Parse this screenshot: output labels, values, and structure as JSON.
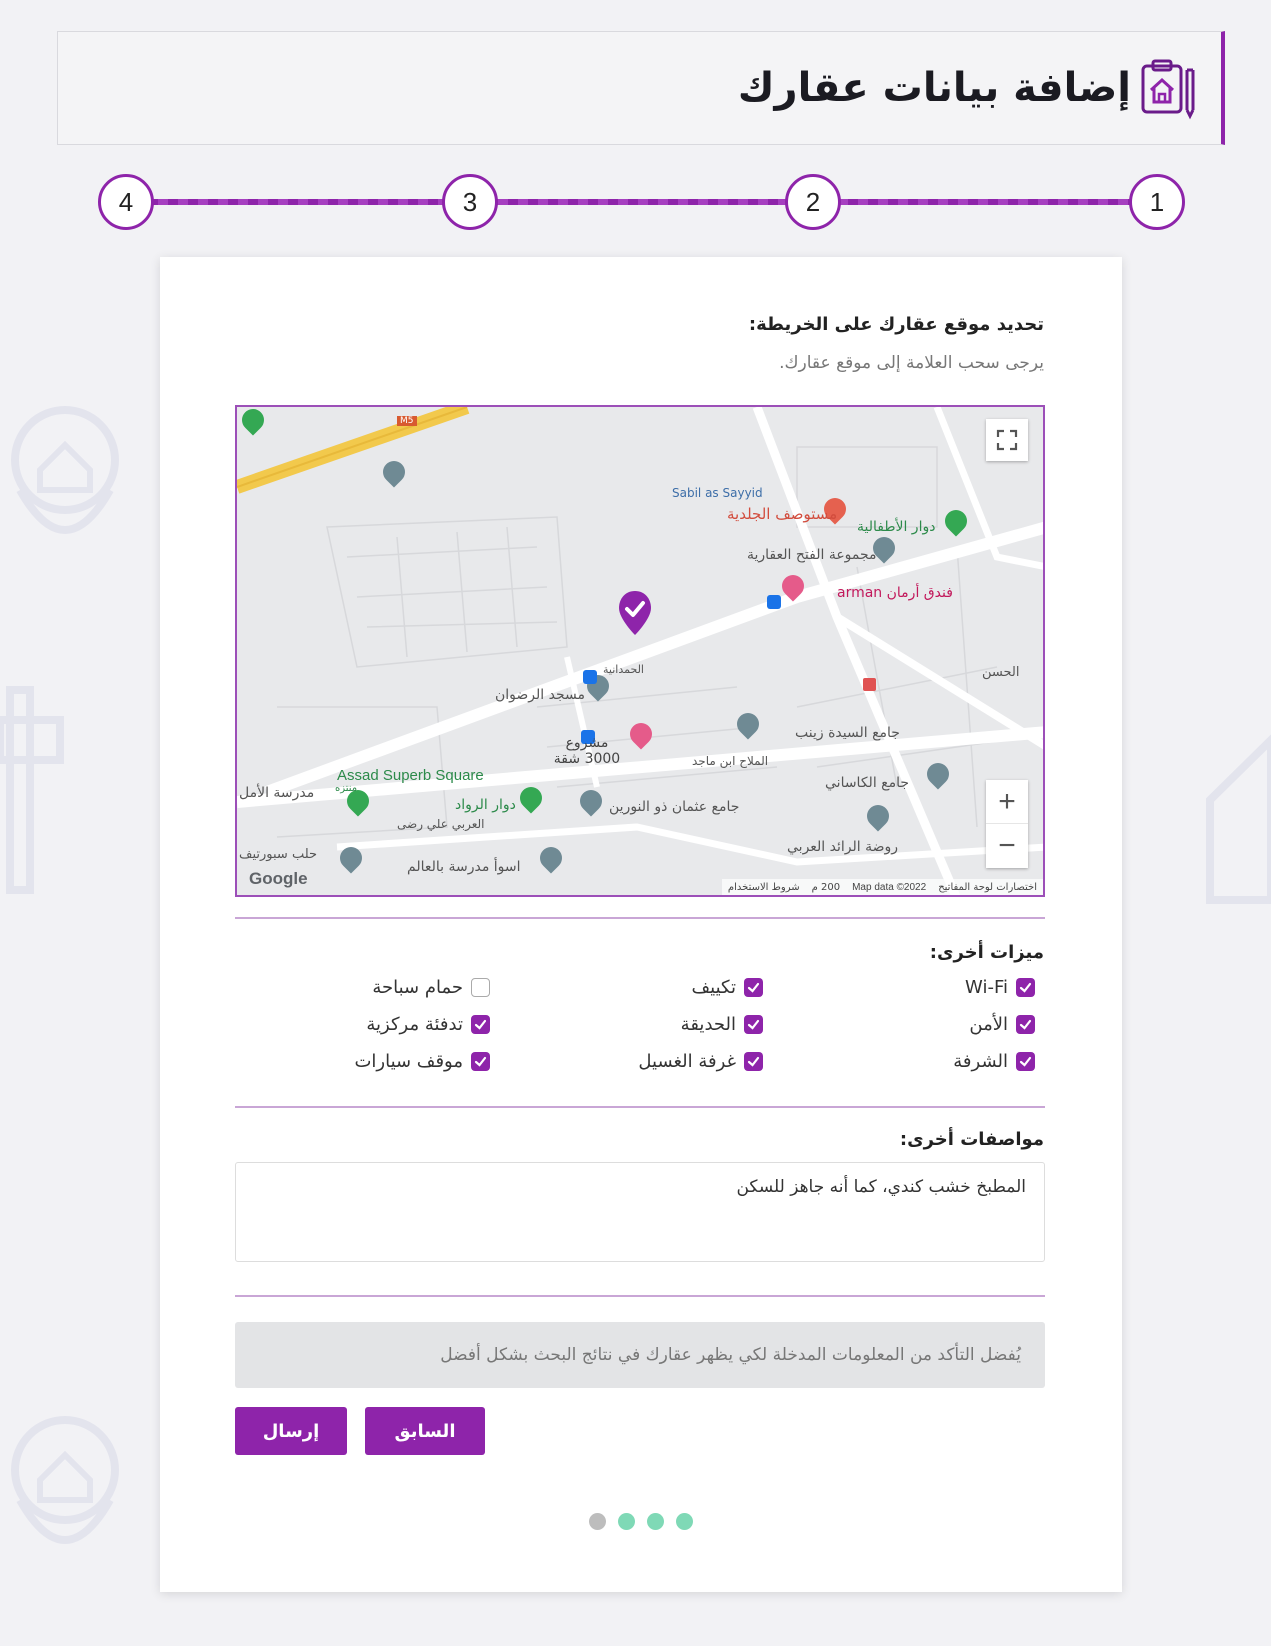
{
  "header": {
    "title": "إضافة بيانات عقارك",
    "icon": "clipboard-house-icon"
  },
  "stepper": {
    "steps": [
      "1",
      "2",
      "3",
      "4"
    ]
  },
  "location": {
    "title": "تحديد موقع عقارك على الخريطة:",
    "subtitle": "يرجى سحب العلامة إلى موقع عقارك."
  },
  "map": {
    "labels": {
      "hospital": "مستوصف الجلدية",
      "sabil": "Sabil as Sayyid",
      "roundabout_children": "دوار الأطفالية",
      "fatah_group": "مجموعة الفتح العقارية",
      "hotel": "فندق أرمان arman",
      "hamdaniya": "الحمدانية",
      "radwan_mosque": "مسجد الرضوان",
      "zainab_mosque": "جامع السيدة زينب",
      "project": "مشروع 3000 شقة",
      "mallah": "الملاح ابن ماجد",
      "assad_square": "Assad Superb Square",
      "park": "منتزه",
      "kasani_mosque": "جامع الكاساني",
      "amal_school": "مدرسة الأمل",
      "rowwad_roundabout": "دوار الرواد",
      "othman_mosque": "جامع عثمان ذو النورين",
      "arabi_ali_reda": "العربي علي رضى",
      "raed_kindergarten": "روضة الرائد العربي",
      "aleppo_sport": "حلب سبورتيف",
      "worst_school": "اسوأ مدرسة بالعالم",
      "hasan": "الحسن",
      "m5": "M5",
      "google": "Google",
      "map_data": "Map data ©2022",
      "scale": "200 م",
      "terms": "شروط الاستخدام",
      "shortcuts": "اختصارات لوحة المفاتيح"
    },
    "zoom_in": "+",
    "zoom_out": "−",
    "accent": "#8e24aa"
  },
  "features": {
    "title": "ميزات أخرى:",
    "items": [
      {
        "label": "Wi-Fi",
        "checked": true
      },
      {
        "label": "تكييف",
        "checked": true
      },
      {
        "label": "حمام سباحة",
        "checked": false
      },
      {
        "label": "الأمن",
        "checked": true
      },
      {
        "label": "الحديقة",
        "checked": true
      },
      {
        "label": "تدفئة مركزية",
        "checked": true
      },
      {
        "label": "الشرفة",
        "checked": true
      },
      {
        "label": "غرفة الغسيل",
        "checked": true
      },
      {
        "label": "موقف سيارات",
        "checked": true
      }
    ]
  },
  "specs": {
    "title": "مواصفات أخرى:",
    "value": "المطبخ خشب كندي، كما أنه جاهز للسكن"
  },
  "notice": "يُفضل التأكد من المعلومات المدخلة لكي يظهر عقارك في نتائج البحث بشكل أفضل",
  "buttons": {
    "previous": "السابق",
    "submit": "إرسال"
  },
  "progress_dots": [
    {
      "color": "#bdbdbd"
    },
    {
      "color": "#7fd9b6"
    },
    {
      "color": "#7fd9b6"
    },
    {
      "color": "#7fd9b6"
    }
  ]
}
